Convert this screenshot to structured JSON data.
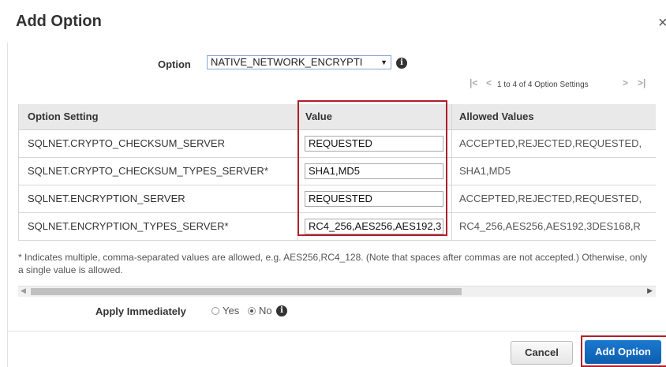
{
  "dialog": {
    "title": "Add Option",
    "close_symbol": "×"
  },
  "option": {
    "label": "Option",
    "selected": "NATIVE_NETWORK_ENCRYPTI",
    "info_icon": "info-icon"
  },
  "pager": {
    "text": "1 to 4 of 4 Option Settings"
  },
  "table": {
    "headers": [
      "Option Setting",
      "Value",
      "Allowed Values"
    ],
    "rows": [
      {
        "setting": "SQLNET.CRYPTO_CHECKSUM_SERVER",
        "value": "REQUESTED",
        "allowed": "ACCEPTED,REJECTED,REQUESTED,"
      },
      {
        "setting": "SQLNET.CRYPTO_CHECKSUM_TYPES_SERVER*",
        "value": "SHA1,MD5",
        "allowed": "SHA1,MD5"
      },
      {
        "setting": "SQLNET.ENCRYPTION_SERVER",
        "value": "REQUESTED",
        "allowed": "ACCEPTED,REJECTED,REQUESTED,"
      },
      {
        "setting": "SQLNET.ENCRYPTION_TYPES_SERVER*",
        "value": "RC4_256,AES256,AES192,3",
        "allowed": "RC4_256,AES256,AES192,3DES168,R"
      }
    ]
  },
  "note": "* Indicates multiple, comma-separated values are allowed, e.g. AES256,RC4_128. (Note that spaces after commas are not accepted.) Otherwise, only a single value is allowed.",
  "apply": {
    "label": "Apply Immediately",
    "options": [
      "Yes",
      "No"
    ],
    "selected": "No"
  },
  "buttons": {
    "cancel": "Cancel",
    "add": "Add Option"
  },
  "colors": {
    "primary": "#1166c0",
    "highlight": "#b11e2b"
  }
}
